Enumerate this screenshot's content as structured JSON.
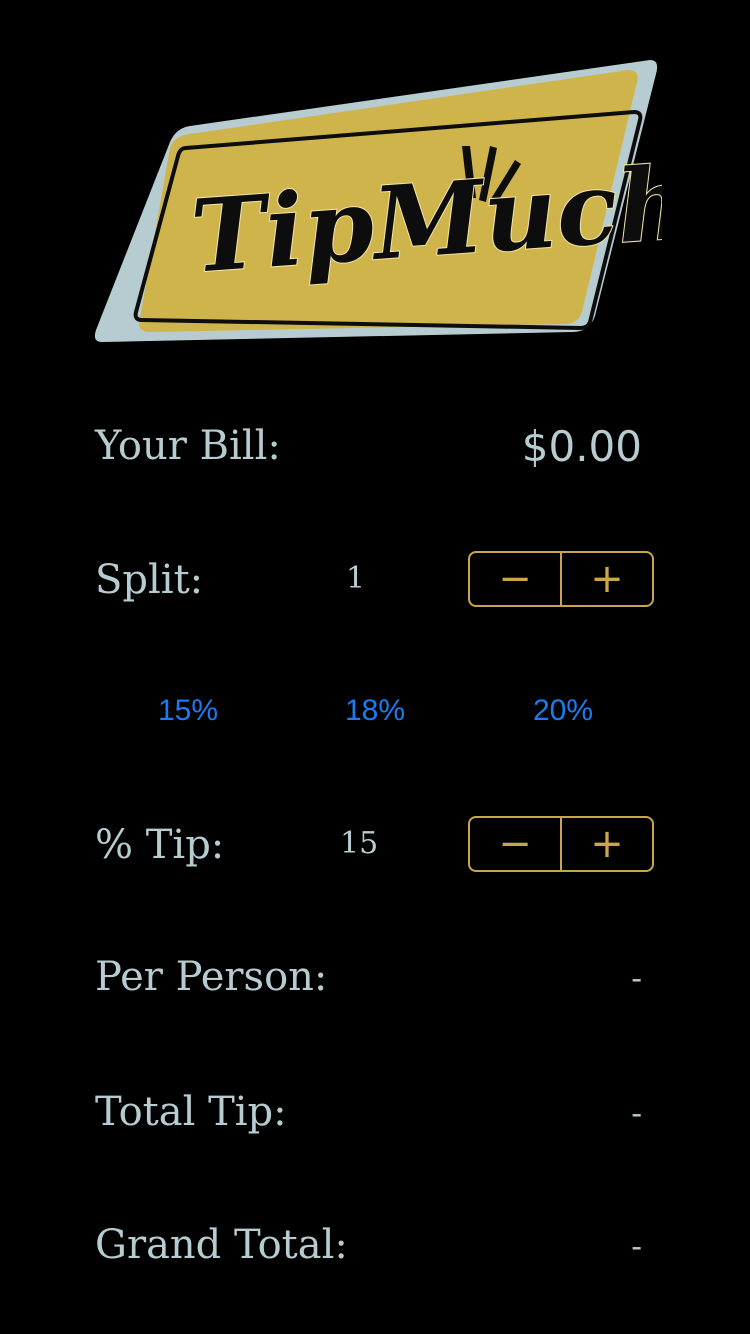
{
  "logo": {
    "text": "TipMuch",
    "colors": {
      "plate": "#b6ccd0",
      "sign": "#cfb44b",
      "ink": "#0d0d0d",
      "highlight": "#f4e6a6"
    }
  },
  "bill": {
    "label": "Your Bill:",
    "value": "$0.00"
  },
  "split": {
    "label": "Split:",
    "value": "1",
    "decrement_label": "−",
    "increment_label": "+"
  },
  "presets": [
    "15%",
    "18%",
    "20%"
  ],
  "tip": {
    "label": "% Tip:",
    "value": "15",
    "decrement_label": "−",
    "increment_label": "+"
  },
  "results": {
    "per_person": {
      "label": "Per Person:",
      "value": "-"
    },
    "total_tip": {
      "label": "Total Tip:",
      "value": "-"
    },
    "grand_total": {
      "label": "Grand Total:",
      "value": "-"
    }
  },
  "colors": {
    "background": "#000000",
    "label_text": "#b7ccd1",
    "stepper_accent": "#c9a64a",
    "preset_link": "#1a7cf2"
  }
}
